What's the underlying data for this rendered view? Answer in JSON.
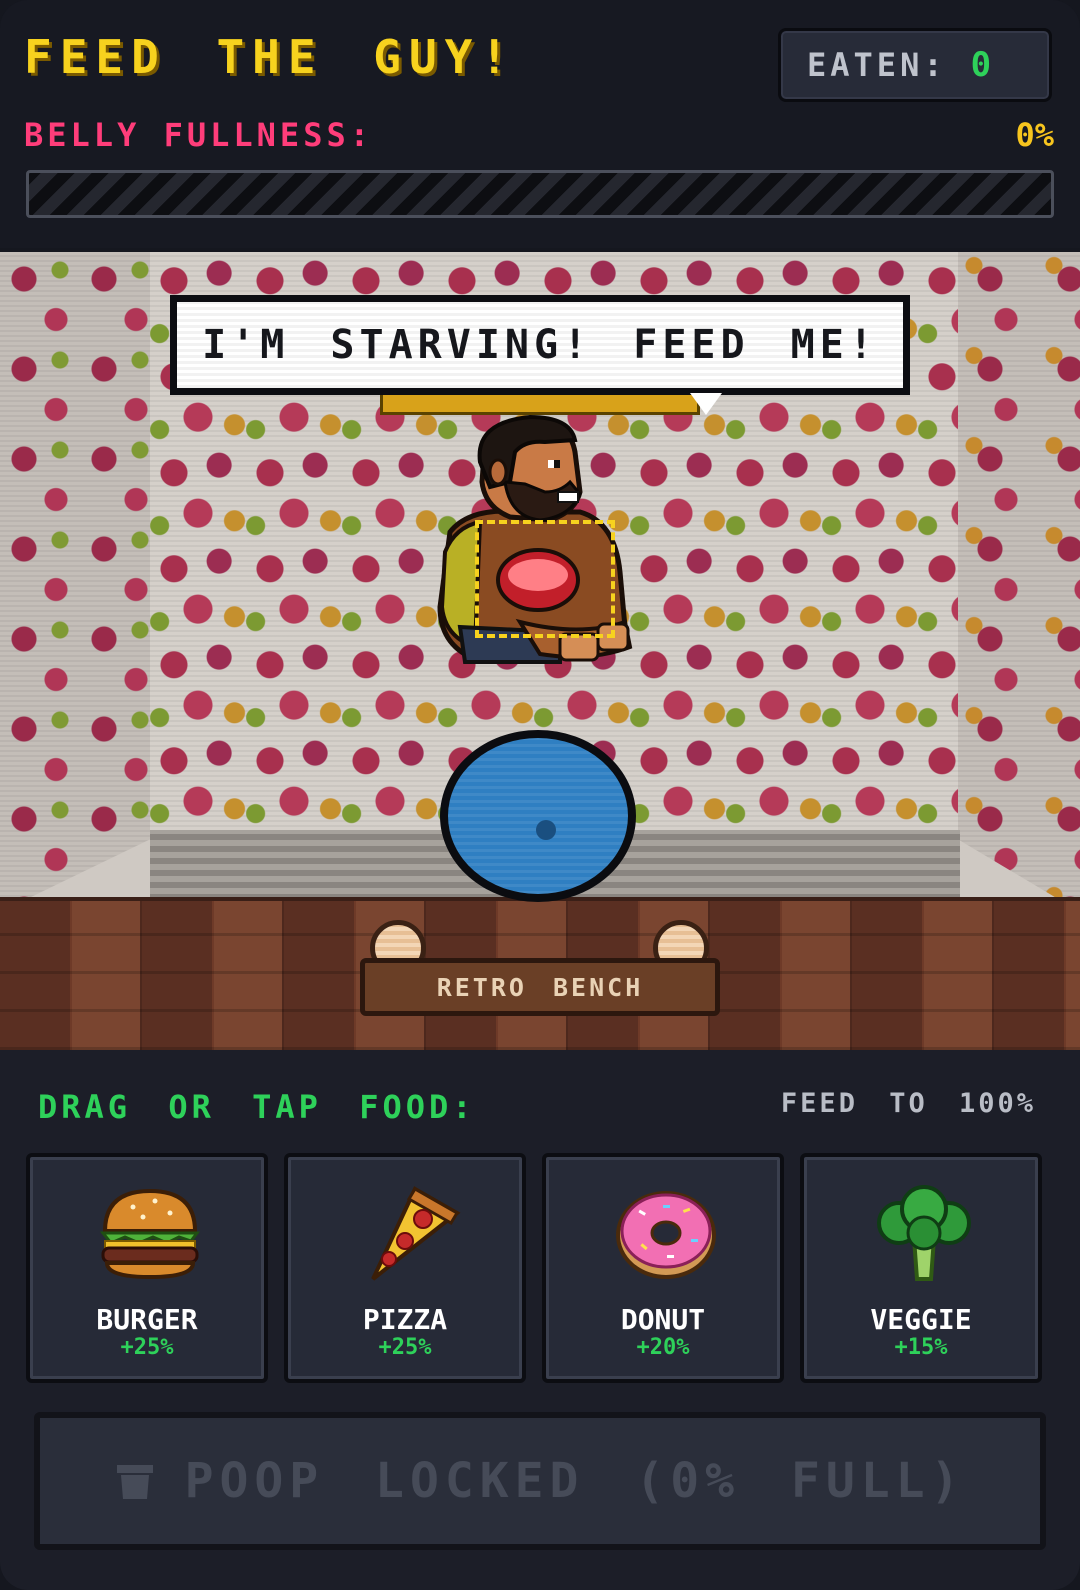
{
  "header": {
    "title": "FEED THE GUY!",
    "eaten_label": "EATEN:",
    "eaten_value": "0",
    "belly_label": "BELLY FULLNESS:",
    "belly_percent_text": "0%",
    "belly_fullness": 0
  },
  "stage": {
    "speech": "I'M STARVING! FEED ME!",
    "bench_label": "RETRO BENCH"
  },
  "food_panel": {
    "prompt": "DRAG OR TAP FOOD:",
    "goal": "FEED TO 100%",
    "items": [
      {
        "name": "BURGER",
        "bonus": "+25%",
        "icon": "burger-icon"
      },
      {
        "name": "PIZZA",
        "bonus": "+25%",
        "icon": "pizza-icon"
      },
      {
        "name": "DONUT",
        "bonus": "+20%",
        "icon": "donut-icon"
      },
      {
        "name": "VEGGIE",
        "bonus": "+15%",
        "icon": "broccoli-icon"
      }
    ]
  },
  "poop_button": {
    "label": "POOP LOCKED (0% FULL)",
    "icon": "trash-can-icon",
    "enabled": false
  },
  "colors": {
    "title": "#f7d21e",
    "belly_label": "#ff3d7a",
    "accent_green": "#2ed15a",
    "plate": "#2f7fc2"
  }
}
